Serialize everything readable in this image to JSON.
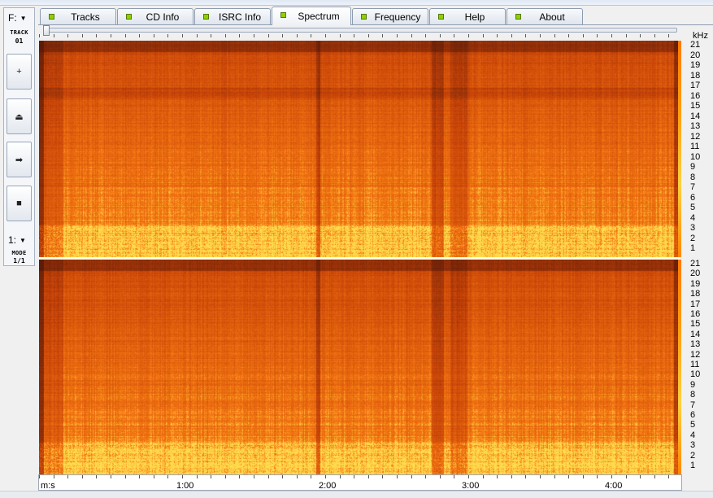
{
  "tabs": [
    {
      "label": "Tracks",
      "active": false
    },
    {
      "label": "CD Info",
      "active": false
    },
    {
      "label": "ISRC Info",
      "active": false
    },
    {
      "label": "Spectrum",
      "active": true
    },
    {
      "label": "Frequency",
      "active": false
    },
    {
      "label": "Help",
      "active": false
    },
    {
      "label": "About",
      "active": false
    }
  ],
  "left_panel": {
    "drive": "F:",
    "track_label": "TRACK",
    "track_value": "01",
    "channel": "1:",
    "mode_label": "MODE",
    "mode_value": "1/1",
    "buttons": [
      {
        "icon": "plus-icon",
        "glyph": "+"
      },
      {
        "icon": "eject-icon",
        "glyph": "⏏"
      },
      {
        "icon": "play-icon",
        "glyph": "➡"
      },
      {
        "icon": "stop-icon",
        "glyph": "■"
      }
    ]
  },
  "spectrum": {
    "unit_label": "kHz",
    "freq_labels": [
      "21",
      "20",
      "19",
      "18",
      "17",
      "16",
      "15",
      "14",
      "13",
      "12",
      "11",
      "10",
      "9",
      "8",
      "7",
      "6",
      "5",
      "4",
      "3",
      "2",
      "1"
    ],
    "time_axis_label": "m:s",
    "time_labels": [
      "1:00",
      "2:00",
      "3:00",
      "4:00"
    ],
    "colors": {
      "dark": "#4a1208",
      "mid": "#d9560a",
      "bright": "#f58a14",
      "hot": "#ffd24a"
    }
  }
}
